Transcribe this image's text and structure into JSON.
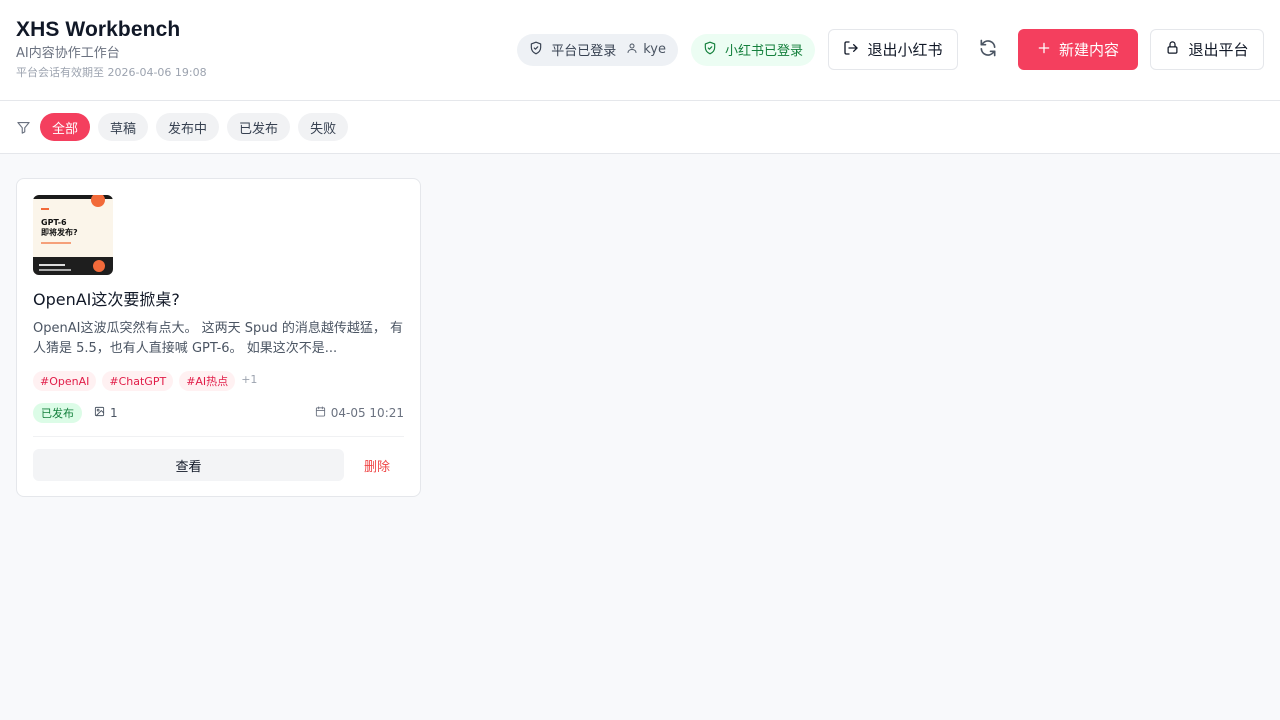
{
  "app": {
    "title": "XHS Workbench",
    "subtitle": "AI内容协作工作台",
    "session": "平台会话有效期至 2026-04-06 19:08"
  },
  "header": {
    "platform_status": "平台已登录",
    "user": "kye",
    "xhs_status": "小红书已登录",
    "logout_xhs_label": "退出小红书",
    "new_content_label": "新建内容",
    "logout_platform_label": "退出平台"
  },
  "filters": {
    "items": [
      "全部",
      "草稿",
      "发布中",
      "已发布",
      "失败"
    ],
    "active": "全部"
  },
  "cards": [
    {
      "thumbnail": {
        "line1": "GPT-6",
        "line2": "即将发布?"
      },
      "title": "OpenAI这次要掀桌?",
      "body": "OpenAI这波瓜突然有点大。 这两天 Spud 的消息越传越猛， 有人猜是 5.5，也有人直接喊 GPT-6。 如果这次不是...",
      "tags": [
        "#OpenAI",
        "#ChatGPT",
        "#AI热点"
      ],
      "tags_more": "+1",
      "status": "已发布",
      "image_count": "1",
      "date": "04-05 10:21",
      "view_label": "查看",
      "delete_label": "删除"
    }
  ],
  "colors": {
    "accent": "#f43f5e",
    "success": "#15803d",
    "danger": "#ef4444"
  },
  "icons": {
    "platform": "shield-check-icon",
    "user": "user-icon",
    "xhs": "shield-check-icon",
    "logout": "logout-icon",
    "refresh": "refresh-icon",
    "new": "plus-icon",
    "lock": "lock-icon",
    "filter": "filter-icon",
    "image": "image-icon",
    "calendar": "calendar-icon"
  }
}
